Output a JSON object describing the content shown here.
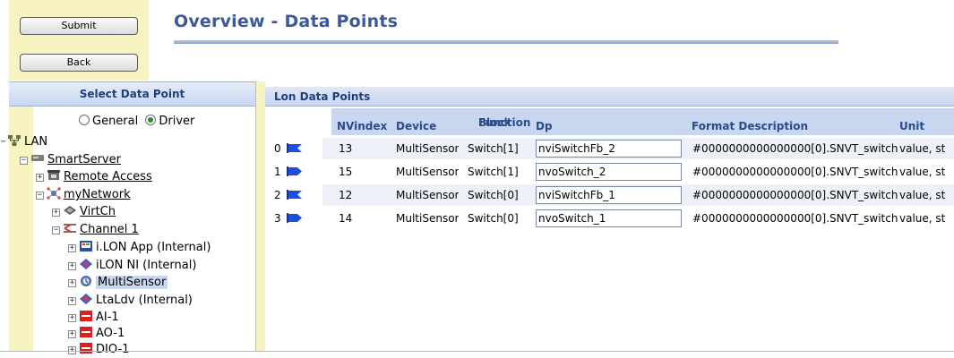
{
  "header": {
    "submit_label": "Submit",
    "back_label": "Back",
    "title": "Overview - Data Points"
  },
  "left_panel": {
    "heading": "Select Data Point",
    "radio_general": "General",
    "radio_driver": "Driver",
    "selected_radio": "Driver",
    "tree": {
      "lan": "LAN",
      "smartserver": "SmartServer",
      "remote_access": "Remote Access",
      "my_network": "myNetwork",
      "virtch": "VirtCh",
      "channel1": "Channel 1",
      "ilon_app": "i.LON App (Internal)",
      "ilon_ni": "iLON NI (Internal)",
      "multisensor": "MultiSensor",
      "ltaldv": "LtaLdv (Internal)",
      "ai1": "AI-1",
      "ao1": "AO-1",
      "dio1": "DIO-1"
    },
    "selected_node": "MultiSensor"
  },
  "main": {
    "section_title": "Lon Data Points",
    "columns": {
      "nvindex": "NVindex",
      "device": "Device",
      "function_block_1": "Function",
      "function_block_2": "Block",
      "dp": "Dp",
      "format_description": "Format Description",
      "unit": "Unit"
    },
    "rows": [
      {
        "index": "0",
        "direction": "input",
        "nvindex": "13",
        "device": "MultiSensor",
        "function_block": "Switch[1]",
        "dp": "nviSwitchFb_2",
        "format": "#0000000000000000[0].SNVT_switch",
        "unit": "value, st"
      },
      {
        "index": "1",
        "direction": "output",
        "nvindex": "15",
        "device": "MultiSensor",
        "function_block": "Switch[1]",
        "dp": "nvoSwitch_2",
        "format": "#0000000000000000[0].SNVT_switch",
        "unit": "value, st"
      },
      {
        "index": "2",
        "direction": "input",
        "nvindex": "12",
        "device": "MultiSensor",
        "function_block": "Switch[0]",
        "dp": "nviSwitchFb_1",
        "format": "#0000000000000000[0].SNVT_switch",
        "unit": "value, st"
      },
      {
        "index": "3",
        "direction": "output",
        "nvindex": "14",
        "device": "MultiSensor",
        "function_block": "Switch[0]",
        "dp": "nvoSwitch_1",
        "format": "#0000000000000000[0].SNVT_switch",
        "unit": "value, st"
      }
    ]
  },
  "colors": {
    "title": "#3b5a97",
    "header_band": "#c9d6f0",
    "sidebar_tint": "#f7f4c2",
    "selection": "#c9d6f0",
    "flag_blue": "#1f4fd8"
  }
}
